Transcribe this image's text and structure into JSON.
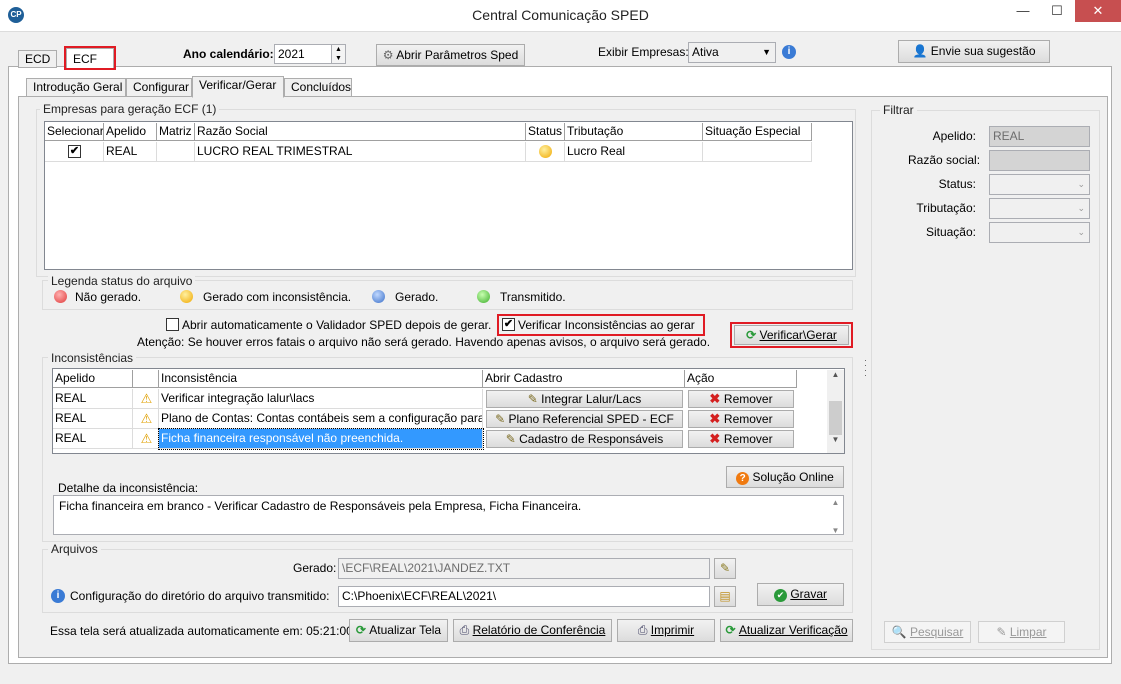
{
  "window": {
    "title": "Central Comunicação SPED",
    "minimize": "—",
    "maximize": "☐",
    "close": "✕",
    "app_icon": "CP"
  },
  "top": {
    "tabs": [
      "ECD",
      "ECF"
    ],
    "year_label": "Ano calendário:",
    "year_value": "2021",
    "params_button": "Abrir Parâmetros Sped",
    "exibir_label": "Exibir Empresas:",
    "exibir_value": "Ativa",
    "suggest_button": "Envie sua sugestão"
  },
  "subtabs": [
    "Introdução Geral",
    "Configurar",
    "Verificar/Gerar",
    "Concluídos"
  ],
  "empresas": {
    "title": "Empresas para geração ECF (1)",
    "columns": [
      "Selecionar",
      "Apelido",
      "Matriz",
      "Razão Social",
      "Status",
      "Tributação",
      "Situação Especial"
    ],
    "rows": [
      {
        "selected": "✔",
        "apelido": "REAL",
        "matriz": "",
        "razao": "LUCRO REAL TRIMESTRAL",
        "status": "yellow",
        "tributacao": "Lucro Real",
        "situacao": ""
      }
    ]
  },
  "legenda": {
    "title": "Legenda status do arquivo",
    "items": [
      {
        "label": "Não gerado.",
        "color": "red"
      },
      {
        "label": "Gerado com inconsistência.",
        "color": "yellow"
      },
      {
        "label": "Gerado.",
        "color": "blue"
      },
      {
        "label": "Transmitido.",
        "color": "green"
      }
    ]
  },
  "options": {
    "auto_validador": "Abrir automaticamente o Validador SPED depois de gerar.",
    "verificar_inconsistencias": "Verificar Inconsistências ao gerar",
    "verificar_checked": "✔",
    "atencao": "Atenção: Se houver erros fatais o arquivo não será gerado. Havendo apenas avisos, o arquivo será gerado.",
    "verificar_gerar_button": "Verificar\\Gerar"
  },
  "inconsistencias": {
    "title": "Inconsistências",
    "columns": [
      "Apelido",
      "",
      "Inconsistência",
      "Abrir Cadastro",
      "Ação"
    ],
    "rows": [
      {
        "apelido": "REAL",
        "inconsistencia": "Verificar integração lalur\\lacs",
        "cadastro": "Integrar Lalur/Lacs",
        "acao": "Remover"
      },
      {
        "apelido": "REAL",
        "inconsistencia": "Plano de Contas: Contas contábeis sem a configuração para o",
        "cadastro": "Plano Referencial SPED - ECF",
        "acao": "Remover"
      },
      {
        "apelido": "REAL",
        "inconsistencia": "Ficha financeira responsável não preenchida.",
        "cadastro": "Cadastro de Responsáveis",
        "acao": "Remover"
      }
    ]
  },
  "solucao_button": "Solução Online",
  "detalhe": {
    "title": "Detalhe da inconsistência:",
    "text": "Ficha financeira em branco - Verificar Cadastro de Responsáveis pela Empresa, Ficha Financeira."
  },
  "arquivos": {
    "title": "Arquivos",
    "gerado_label": "Gerado:",
    "gerado_value": "\\ECF\\REAL\\2021\\JANDEZ.TXT",
    "config_label": "Configuração do diretório do arquivo transmitido:",
    "config_value": "C:\\Phoenix\\ECF\\REAL\\2021\\",
    "gravar_button": "Gravar"
  },
  "footer": {
    "auto_update": "Essa tela será atualizada automaticamente em: 05:21:00",
    "buttons": [
      "Atualizar Tela",
      "Relatório de Conferência",
      "Imprimir",
      "Atualizar Verificação"
    ]
  },
  "filtrar": {
    "title": "Filtrar",
    "apelido_label": "Apelido:",
    "apelido_value": "REAL",
    "razao_label": "Razão social:",
    "razao_value": "",
    "status_label": "Status:",
    "tributacao_label": "Tributação:",
    "situacao_label": "Situação:",
    "pesquisar_button": "Pesquisar",
    "limpar_button": "Limpar"
  }
}
